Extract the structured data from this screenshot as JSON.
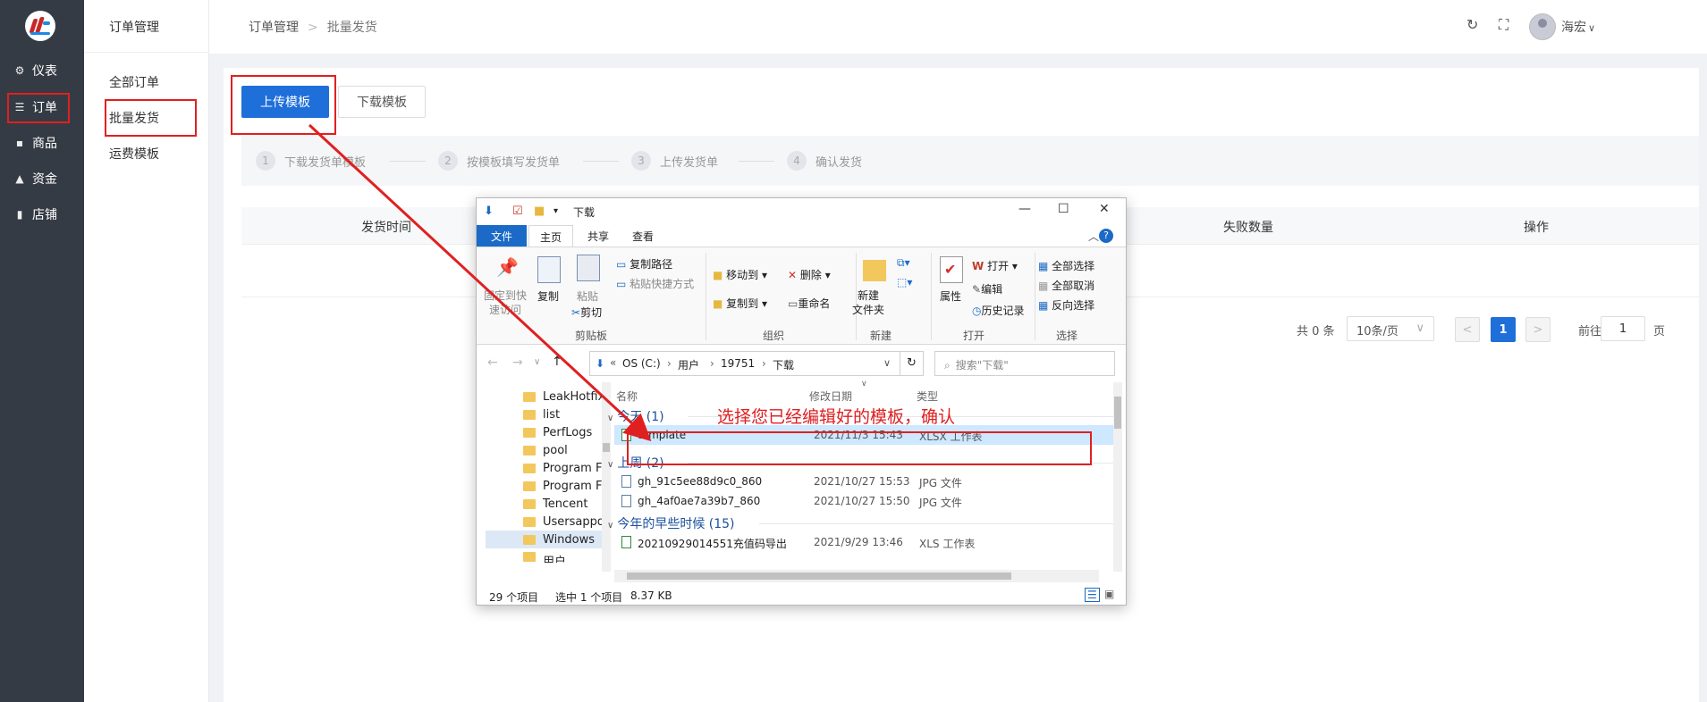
{
  "rail": {
    "items": [
      {
        "icon": "gear-icon",
        "glyph": "⚙",
        "label": "仪表"
      },
      {
        "icon": "list-icon",
        "glyph": "☰",
        "label": "订单"
      },
      {
        "icon": "lock-icon",
        "glyph": "🔒",
        "label": "商品"
      },
      {
        "icon": "chart-icon",
        "glyph": "▲",
        "label": "资金"
      },
      {
        "icon": "store-icon",
        "glyph": "▮",
        "label": "店铺"
      }
    ]
  },
  "side2": {
    "title": "订单管理",
    "items": [
      "全部订单",
      "批量发货",
      "运费模板"
    ]
  },
  "header": {
    "breadcrumb": [
      "订单管理",
      "批量发货"
    ],
    "breadcrumb_sep": ">",
    "user": "海宏",
    "refresh_glyph": "↻",
    "fullscreen_glyph": "⛶",
    "dropdown_glyph": "∨"
  },
  "toolbar": {
    "upload": "上传模板",
    "download": "下载模板"
  },
  "steps": [
    {
      "num": "1",
      "label": "下载发货单模板"
    },
    {
      "num": "2",
      "label": "按模板填写发货单"
    },
    {
      "num": "3",
      "label": "上传发货单"
    },
    {
      "num": "4",
      "label": "确认发货"
    }
  ],
  "table": {
    "headers": [
      "发货时间",
      "失败数量",
      "操作"
    ]
  },
  "pager": {
    "total": "共 0 条",
    "page_size": "10条/页",
    "prev": "<",
    "current": "1",
    "next": ">",
    "goto_prefix": "前往",
    "goto_value": "1",
    "goto_suffix": "页"
  },
  "explorer": {
    "title": "下载",
    "controls": {
      "min": "—",
      "max": "☐",
      "close": "✕"
    },
    "tabs": [
      "文件",
      "主页",
      "共享",
      "查看"
    ],
    "ribbon": {
      "pin": "固定到快\n速访问",
      "copy": "复制",
      "paste": "粘贴",
      "copy_path": "复制路径",
      "paste_shortcut": "粘贴快捷方式",
      "cut": "剪切",
      "clipboard": "剪贴板",
      "move_to": "移动到",
      "copy_to": "复制到",
      "delete": "删除",
      "rename": "重命名",
      "organize": "组织",
      "new_folder": "新建\n文件夹",
      "new": "新建",
      "properties": "属性",
      "open": "打开",
      "edit": "编辑",
      "history": "历史记录",
      "open_group": "打开",
      "select_all": "全部选择",
      "select_none": "全部取消",
      "invert": "反向选择",
      "select_group": "选择"
    },
    "address": [
      "OS (C:)",
      "用户",
      "19751",
      "下载"
    ],
    "search_placeholder": "搜索\"下载\"",
    "nav": [
      "LeakHotfix",
      "list",
      "PerfLogs",
      "pool",
      "Program Files",
      "Program Files",
      "Tencent",
      "Usersappdata",
      "Windows",
      "用户"
    ],
    "columns": {
      "name": "名称",
      "date": "修改日期",
      "type": "类型"
    },
    "groups": [
      {
        "label": "今天 (1)",
        "files": [
          {
            "name": "template",
            "date": "2021/11/3 15:43",
            "type": "XLSX 工作表",
            "selected": true
          }
        ]
      },
      {
        "label": "上周 (2)",
        "files": [
          {
            "name": "gh_91c5ee88d9c0_860",
            "date": "2021/10/27 15:53",
            "type": "JPG 文件",
            "selected": false
          },
          {
            "name": "gh_4af0ae7a39b7_860",
            "date": "2021/10/27 15:50",
            "type": "JPG 文件",
            "selected": false
          }
        ]
      },
      {
        "label": "今年的早些时候 (15)",
        "files": [
          {
            "name": "20210929014551充值码导出",
            "date": "2021/9/29 13:46",
            "type": "XLS 工作表",
            "selected": false
          }
        ]
      }
    ],
    "status": {
      "count": "29 个项目",
      "selected": "选中 1 个项目",
      "size": "8.37 KB"
    }
  },
  "annotation": "选择您已经编辑好的模板，确认",
  "colors": {
    "primary": "#1e6fd9",
    "annotation": "#e02020",
    "rail": "#353b44"
  }
}
